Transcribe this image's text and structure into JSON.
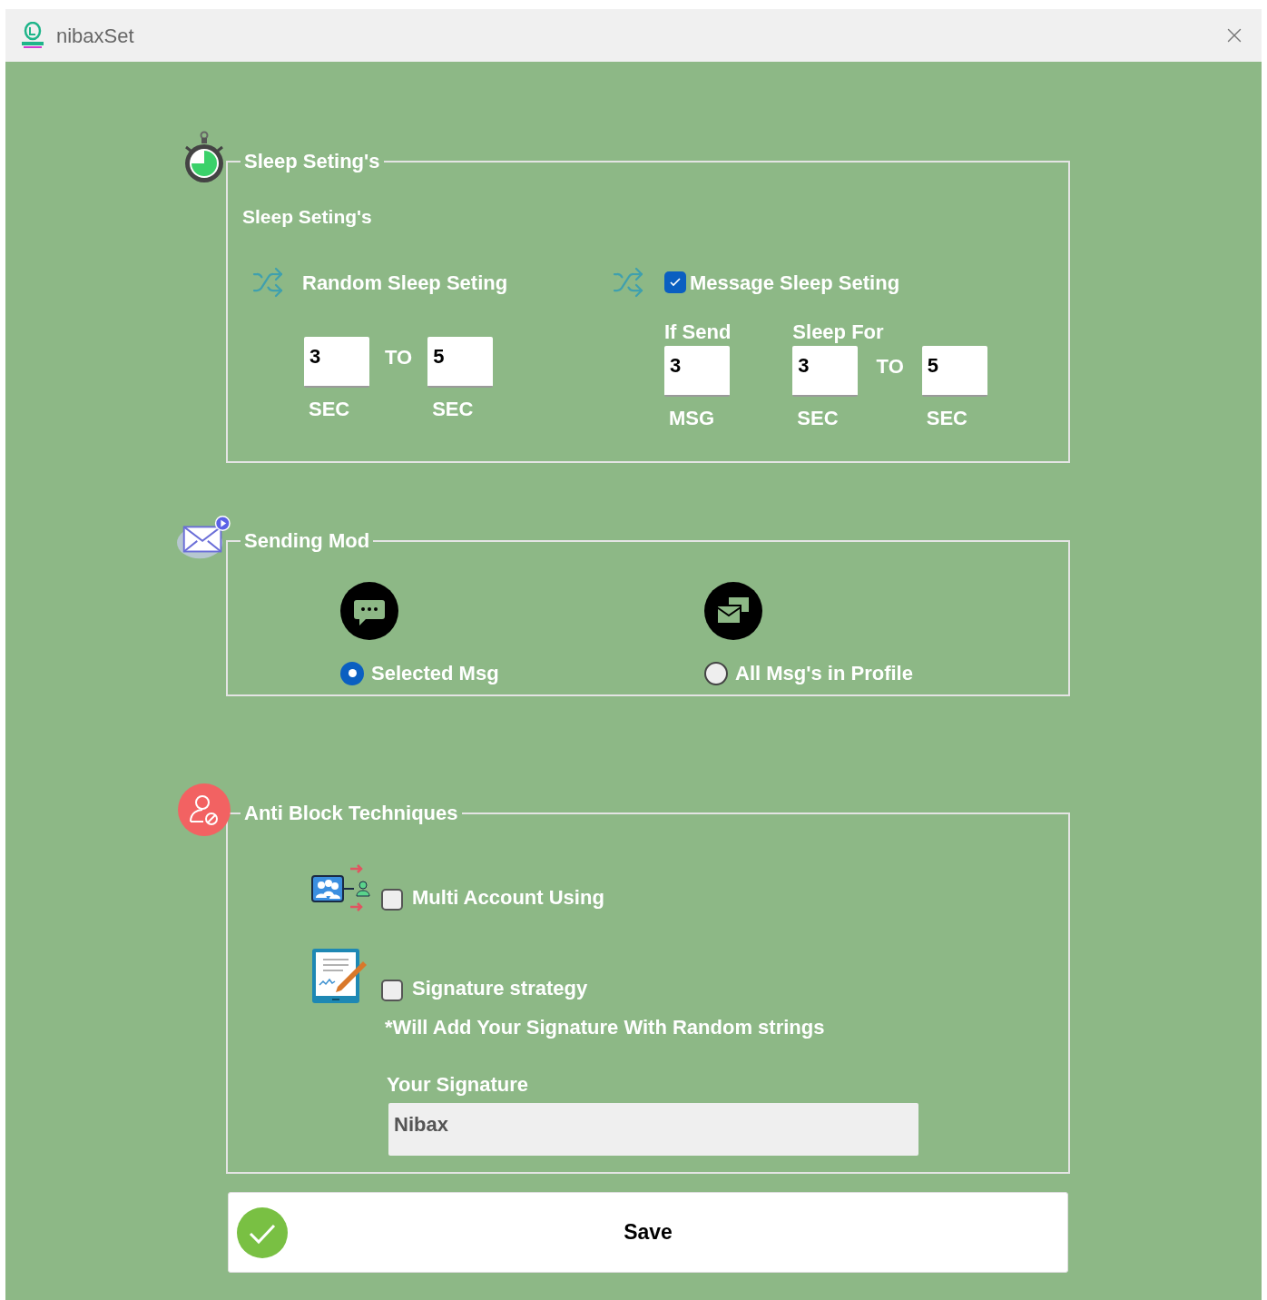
{
  "window": {
    "title": "nibaxSet"
  },
  "sleep_settings": {
    "title": "Sleep Seting's",
    "subtitle": "Sleep Seting's",
    "random": {
      "label": "Random Sleep Seting",
      "from": "3",
      "from_unit": "SEC",
      "to_label": "TO",
      "to": "5",
      "to_unit": "SEC"
    },
    "message": {
      "label": "Message Sleep Seting",
      "checked": true,
      "if_send_label": "If Send",
      "if_send": "3",
      "if_send_unit": "MSG",
      "sleep_for_label": "Sleep For",
      "from": "3",
      "from_unit": "SEC",
      "to_label": "TO",
      "to": "5",
      "to_unit": "SEC"
    }
  },
  "sending_mode": {
    "title": "Sending Mod",
    "options": [
      {
        "label": "Selected Msg",
        "selected": true,
        "kind": "chat"
      },
      {
        "label": "All Msg's in Profile",
        "selected": false,
        "kind": "mail"
      }
    ]
  },
  "anti_block": {
    "title": "Anti Block Techniques",
    "options": [
      {
        "label": "Multi Account Using",
        "checked": false,
        "kind": "accounts"
      },
      {
        "label": "Signature strategy",
        "checked": false,
        "kind": "signature"
      }
    ],
    "note": "*Will Add Your Signature With Random strings",
    "signature_label": "Your Signature",
    "signature_value": "Nibax"
  },
  "save_button": "Save"
}
